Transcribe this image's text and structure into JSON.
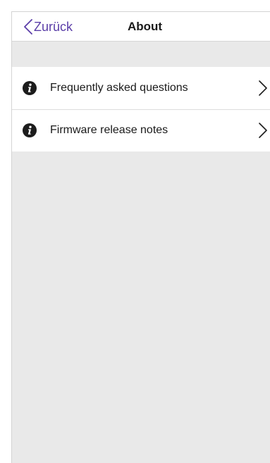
{
  "navbar": {
    "back_label": "Zurück",
    "title": "About",
    "accent_color": "#5b3ea8"
  },
  "menu": {
    "items": [
      {
        "icon": "info-icon",
        "label": "Frequently asked questions",
        "trailing_icon": "chevron-right-icon"
      },
      {
        "icon": "info-icon",
        "label": "Firmware release notes",
        "trailing_icon": "chevron-right-icon"
      }
    ]
  },
  "colors": {
    "background": "#e9e9e9",
    "surface": "#ffffff",
    "text": "#1a1a1a"
  }
}
